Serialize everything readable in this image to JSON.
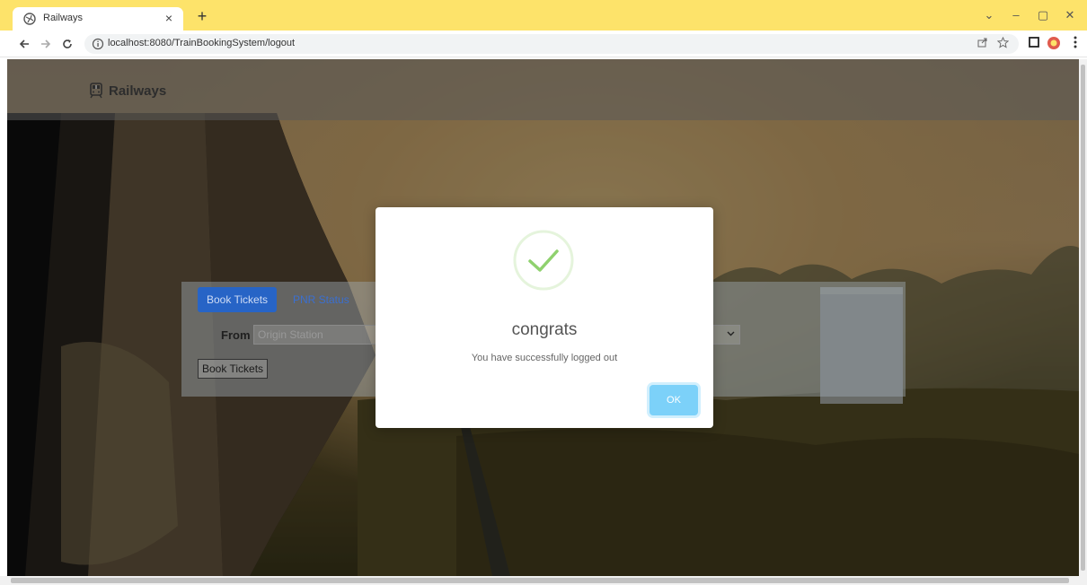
{
  "browser": {
    "tab_title": "Railways",
    "tab_close": "×",
    "new_tab": "+",
    "url": "localhost:8080/TrainBookingSystem/logout",
    "window_controls": [
      "⌄",
      "–",
      "▢",
      "✕"
    ],
    "colors": {
      "tabstrip": "#fde36a",
      "extension_badge": "#e05b4d"
    },
    "icons": [
      "globe-icon",
      "back-icon",
      "forward-icon",
      "reload-icon",
      "info-icon",
      "share-icon",
      "star-icon",
      "sidepanel-icon",
      "extension-icon",
      "menu-icon"
    ]
  },
  "site": {
    "brand": "Railways",
    "brand_icon": "train-icon"
  },
  "booking": {
    "tabs": [
      {
        "label": "Book Tickets",
        "active": true
      },
      {
        "label": "PNR Status",
        "active": false
      }
    ],
    "from_label": "From",
    "from_placeholder": "Origin Station",
    "submit_label": "Book Tickets"
  },
  "modal": {
    "icon": "success-check-icon",
    "title": "congrats",
    "message": "You have successfully logged out",
    "ok_label": "OK",
    "colors": {
      "check": "#8fd16e",
      "ok_button": "#7cd1f9"
    }
  }
}
